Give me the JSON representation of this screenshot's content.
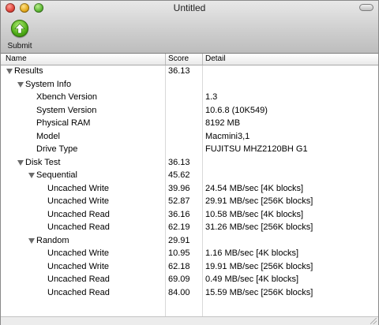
{
  "window": {
    "title": "Untitled"
  },
  "toolbar": {
    "submit_label": "Submit",
    "submit_icon": "green-up-arrow-icon"
  },
  "columns": {
    "name": "Name",
    "score": "Score",
    "detail": "Detail"
  },
  "rows": [
    {
      "name": "Results",
      "score": "36.13",
      "detail": "",
      "level": 0,
      "expanded": true
    },
    {
      "name": "System Info",
      "score": "",
      "detail": "",
      "level": 1,
      "expanded": true
    },
    {
      "name": "Xbench Version",
      "score": "",
      "detail": "1.3",
      "level": 2
    },
    {
      "name": "System Version",
      "score": "",
      "detail": "10.6.8 (10K549)",
      "level": 2
    },
    {
      "name": "Physical RAM",
      "score": "",
      "detail": "8192 MB",
      "level": 2
    },
    {
      "name": "Model",
      "score": "",
      "detail": "Macmini3,1",
      "level": 2
    },
    {
      "name": "Drive Type",
      "score": "",
      "detail": "FUJITSU MHZ2120BH G1",
      "level": 2
    },
    {
      "name": "Disk Test",
      "score": "36.13",
      "detail": "",
      "level": 1,
      "expanded": true
    },
    {
      "name": "Sequential",
      "score": "45.62",
      "detail": "",
      "level": 2,
      "expanded": true
    },
    {
      "name": "Uncached Write",
      "score": "39.96",
      "detail": "24.54 MB/sec [4K blocks]",
      "level": 3
    },
    {
      "name": "Uncached Write",
      "score": "52.87",
      "detail": "29.91 MB/sec [256K blocks]",
      "level": 3
    },
    {
      "name": "Uncached Read",
      "score": "36.16",
      "detail": "10.58 MB/sec [4K blocks]",
      "level": 3
    },
    {
      "name": "Uncached Read",
      "score": "62.19",
      "detail": "31.26 MB/sec [256K blocks]",
      "level": 3
    },
    {
      "name": "Random",
      "score": "29.91",
      "detail": "",
      "level": 2,
      "expanded": true
    },
    {
      "name": "Uncached Write",
      "score": "10.95",
      "detail": "1.16 MB/sec [4K blocks]",
      "level": 3
    },
    {
      "name": "Uncached Write",
      "score": "62.18",
      "detail": "19.91 MB/sec [256K blocks]",
      "level": 3
    },
    {
      "name": "Uncached Read",
      "score": "69.09",
      "detail": "0.49 MB/sec [4K blocks]",
      "level": 3
    },
    {
      "name": "Uncached Read",
      "score": "84.00",
      "detail": "15.59 MB/sec [256K blocks]",
      "level": 3
    }
  ]
}
